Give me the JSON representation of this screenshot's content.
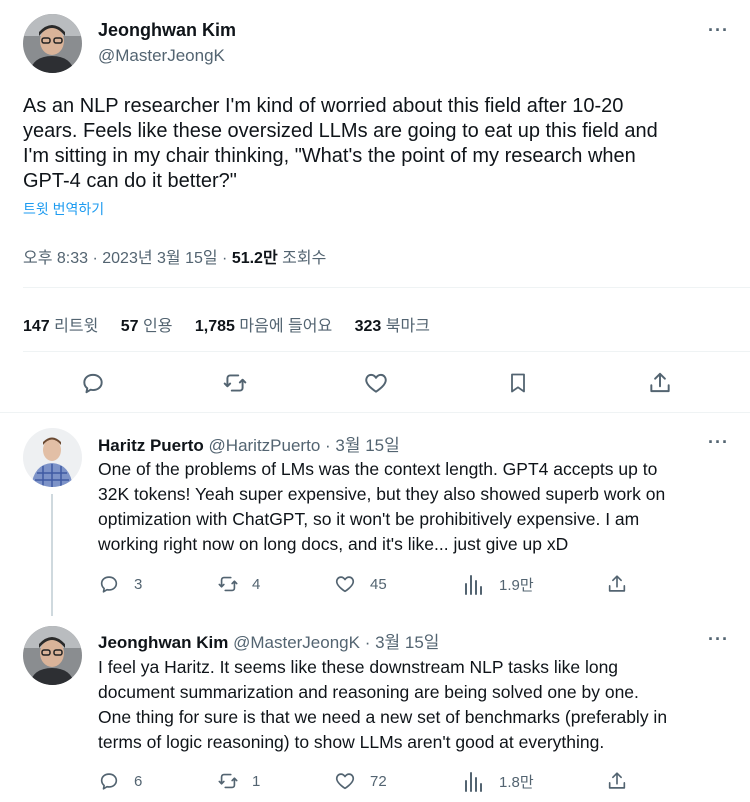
{
  "main_tweet": {
    "author_name": "Jeonghwan Kim",
    "author_handle": "@MasterJeongK",
    "text_lines": [
      "As an NLP researcher I'm kind of worried about this field after 10-20",
      "years. Feels like these oversized LLMs are going to eat up this field and",
      "I'm sitting in my chair thinking, \"What's the point of my research when",
      "GPT-4 can do it better?\""
    ],
    "translate_label": "트윗 번역하기",
    "timestamp": "오후 8:33 · 2023년 3월 15일 · ",
    "views_count": "51.2만",
    "views_label": " 조회수",
    "stats": {
      "retweets_count": "147",
      "retweets_label": " 리트윗",
      "quotes_count": "57",
      "quotes_label": " 인용",
      "likes_count": "1,785",
      "likes_label": " 마음에 들어요",
      "bookmarks_count": "323",
      "bookmarks_label": " 북마크"
    }
  },
  "replies": [
    {
      "author_name": "Haritz Puerto",
      "author_handle": "@HaritzPuerto",
      "date": " · 3월 15일",
      "text_lines": [
        "One of the problems of LMs was the context length. GPT4 accepts up to",
        "32K tokens! Yeah super expensive, but they also showed superb work on",
        "optimization with ChatGPT, so it won't be prohibitively expensive. I am",
        "working right now on long docs, and it's like... just give up xD"
      ],
      "replies_count": "3",
      "retweets_count": "4",
      "likes_count": "45",
      "views_count": "1.9만"
    },
    {
      "author_name": "Jeonghwan Kim",
      "author_handle": "@MasterJeongK",
      "date": " · 3월 15일",
      "text_lines": [
        "I feel ya Haritz. It seems like these downstream NLP tasks like long",
        "document summarization and reasoning are being solved one by one.",
        "One thing for sure is that we need a new set of benchmarks (preferably in",
        "terms of logic reasoning)  to show LLMs aren't good at everything."
      ],
      "replies_count": "6",
      "retweets_count": "1",
      "likes_count": "72",
      "views_count": "1.8만"
    }
  ],
  "more_icon_glyph": "···",
  "colors": {
    "link": "#1d9bf0",
    "secondary": "#536471",
    "border": "#eff3f4"
  }
}
